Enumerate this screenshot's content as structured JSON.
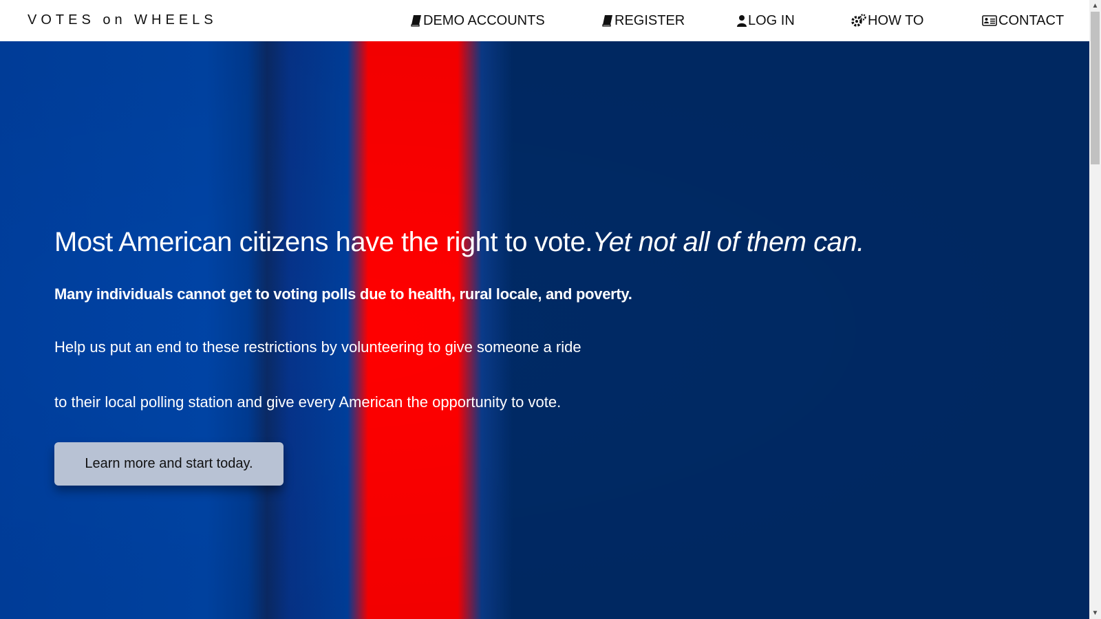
{
  "brand": "VOTES on WHEELS",
  "nav": {
    "demo_accounts": "DEMO ACCOUNTS",
    "register": "REGISTER",
    "login": "LOG IN",
    "how_to": "HOW TO",
    "contact": "CONTACT"
  },
  "hero": {
    "headline": "Most American citizens have the right to vote.",
    "headline_emphasis": "Yet not all of them can.",
    "subhead": "Many individuals cannot get to voting polls due to health, rural locale, and poverty.",
    "body_line_1": "Help us put an end to these restrictions by volunteering to give someone a ride",
    "body_line_2": "to their local polling station and give every American the opportunity to vote.",
    "cta_label": "Learn more and start today."
  },
  "colors": {
    "nav_background": "#ffffff",
    "hero_blue": "#002a66",
    "hero_red": "#ff0000",
    "cta_background": "#b8c2d4"
  },
  "icons": {
    "demo_accounts": "book-icon",
    "register": "book-icon",
    "login": "user-icon",
    "how_to": "gears-icon",
    "contact": "address-card-icon"
  }
}
